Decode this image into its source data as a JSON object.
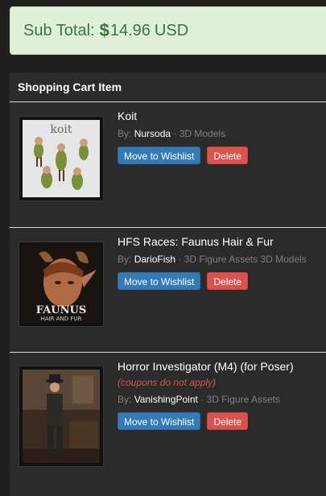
{
  "subtotal": {
    "label": "Sub Total:",
    "currency_symbol": "$",
    "amount": "14.96",
    "currency": "USD"
  },
  "cart": {
    "heading": "Shopping Cart Item",
    "by_label": "By:",
    "separator": "·",
    "items": [
      {
        "title": "Koit",
        "note": "",
        "author": "Nursoda",
        "categories": "3D Models",
        "thumb_caption": "koit",
        "wishlist_label": "Move to Wishlist",
        "delete_label": "Delete"
      },
      {
        "title": "HFS Races: Faunus Hair & Fur",
        "note": "",
        "author": "DarioFish",
        "categories": "3D Figure Assets 3D Models",
        "thumb_caption": "FAUNUS",
        "thumb_subcaption": "HAIR AND FUR",
        "wishlist_label": "Move to Wishlist",
        "delete_label": "Delete"
      },
      {
        "title": "Horror Investigator (M4) (for Poser)",
        "note": "(coupons do not apply)",
        "author": "VanishingPoint",
        "categories": "3D Figure Assets",
        "thumb_caption": "",
        "wishlist_label": "Move to Wishlist",
        "delete_label": "Delete"
      }
    ]
  },
  "colors": {
    "success_bg": "#dff0d8",
    "success_text": "#3c763d",
    "primary": "#337ab7",
    "danger": "#d9534f"
  }
}
